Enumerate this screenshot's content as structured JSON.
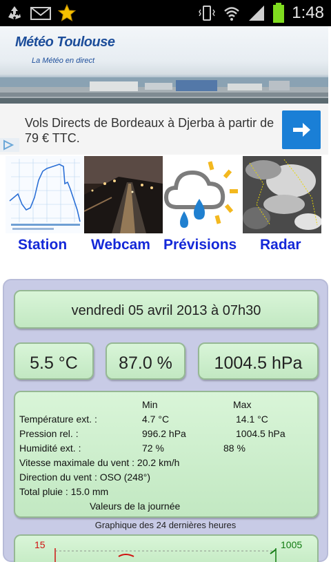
{
  "status_bar": {
    "time": "1:48",
    "left_icons": [
      "recycle-icon",
      "mail-icon",
      "star-icon"
    ],
    "right_icons": [
      "vibrate-icon",
      "wifi-icon",
      "signal-icon",
      "battery-icon"
    ]
  },
  "banner": {
    "title": "Météo Toulouse",
    "subtitle": "La Météo en direct"
  },
  "ad": {
    "text": "Vols Directs de Bordeaux à Djerba à partir de 79 € TTC.",
    "button_icon": "arrow-right-icon",
    "badge_icon": "adchoices-icon"
  },
  "nav": [
    {
      "label": "Station",
      "icon": "station-graph-thumbnail"
    },
    {
      "label": "Webcam",
      "icon": "webcam-thumbnail"
    },
    {
      "label": "Prévisions",
      "icon": "rain-sun-icon"
    },
    {
      "label": "Radar",
      "icon": "radar-thumbnail"
    }
  ],
  "current": {
    "date": "vendredi 05 avril 2013 à 07h30",
    "temperature": "5.5 °C",
    "humidity": "87.0 %",
    "pressure": "1004.5 hPa"
  },
  "details": {
    "col_min": "Min",
    "col_max": "Max",
    "temp_label": "Température ext. :",
    "temp_min": "4.7 °C",
    "temp_max": "14.1 °C",
    "press_label": "Pression rel. :",
    "press_min": "996.2 hPa",
    "press_max": "1004.5 hPa",
    "hum_label": "Humidité ext. :",
    "hum_min": "72 %",
    "hum_max": "88 %",
    "wind_max": "Vitesse maximale du vent : 20.2 km/h",
    "wind_dir": "Direction du vent : OSO (248°)",
    "rain": "Total pluie : 15.0 mm",
    "footer": "Valeurs de la journée"
  },
  "graph": {
    "caption": "Graphique des 24 dernières heures",
    "left_axis_top": "15",
    "right_axis_top": "1005"
  }
}
